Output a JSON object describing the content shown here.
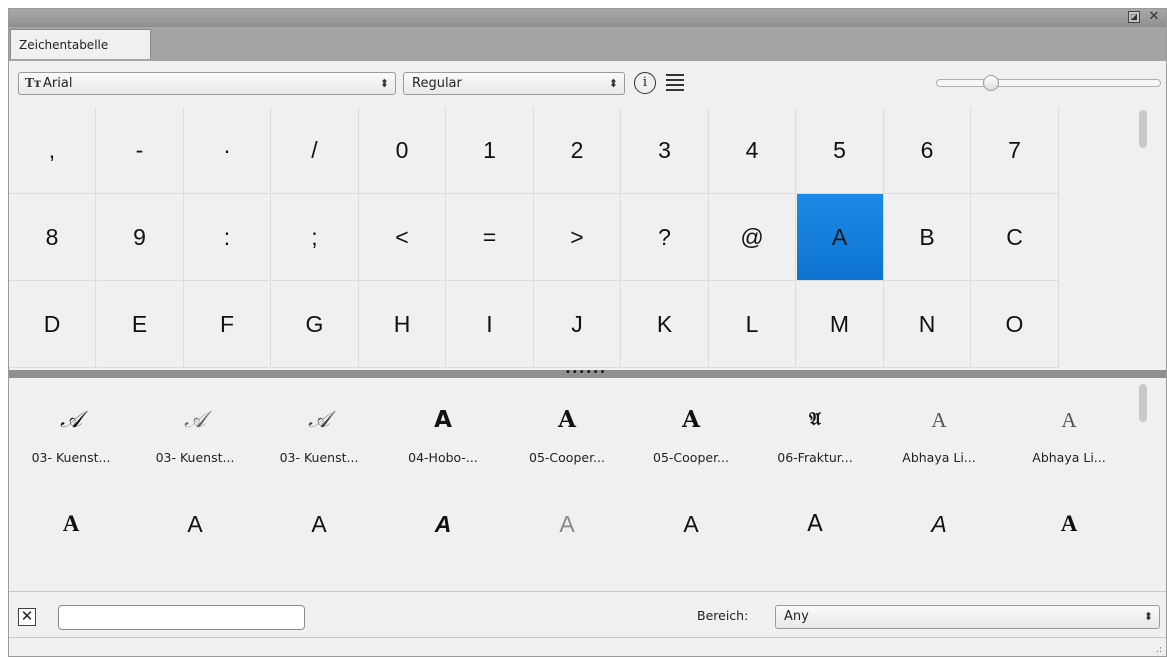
{
  "window": {
    "float_icon_glyph": "◪",
    "close_icon_glyph": "✕"
  },
  "tab": {
    "label": "Zeichentabelle"
  },
  "toolbar": {
    "font_select_value": "Arial",
    "font_type_icon_glyph": "Tт",
    "style_select_value": "Regular",
    "select_arrows": "⬍",
    "info_icon_glyph": "i"
  },
  "size_slider": {
    "value_fraction": 0.22
  },
  "glyphs": [
    ",",
    "-",
    "·",
    "/",
    "0",
    "1",
    "2",
    "3",
    "4",
    "5",
    "6",
    "7",
    "8",
    "9",
    ":",
    ";",
    "<",
    "=",
    ">",
    "?",
    "@",
    "A",
    "B",
    "C",
    "D",
    "E",
    "F",
    "G",
    "H",
    "I",
    "J",
    "K",
    "L",
    "M",
    "N",
    "O"
  ],
  "selected_glyph_index": 21,
  "divider": {
    "grip": "••••••"
  },
  "fonts": [
    {
      "sample": "𝒜",
      "name": "03- Kuenst..."
    },
    {
      "sample": "𝒜",
      "name": "03- Kuenst..."
    },
    {
      "sample": "𝒜",
      "name": "03- Kuenst..."
    },
    {
      "sample": "A",
      "name": "04-Hobo-..."
    },
    {
      "sample": "A",
      "name": "05-Cooper..."
    },
    {
      "sample": "A",
      "name": "05-Cooper..."
    },
    {
      "sample": "𝔄",
      "name": "06-Fraktur..."
    },
    {
      "sample": "A",
      "name": "Abhaya Li..."
    },
    {
      "sample": "A",
      "name": "Abhaya Li..."
    },
    {
      "sample": "A",
      "name": ""
    },
    {
      "sample": "A",
      "name": ""
    },
    {
      "sample": "A",
      "name": ""
    },
    {
      "sample": "A",
      "name": ""
    },
    {
      "sample": "A",
      "name": ""
    },
    {
      "sample": "A",
      "name": ""
    },
    {
      "sample": "A",
      "name": ""
    },
    {
      "sample": "A",
      "name": ""
    },
    {
      "sample": "A",
      "name": ""
    }
  ],
  "bottom": {
    "clear_icon_glyph": "✕",
    "search_value": "",
    "range_label": "Bereich:",
    "range_value": "Any",
    "range_arrows": "⬍",
    "resize_grip_glyph": ".:"
  }
}
